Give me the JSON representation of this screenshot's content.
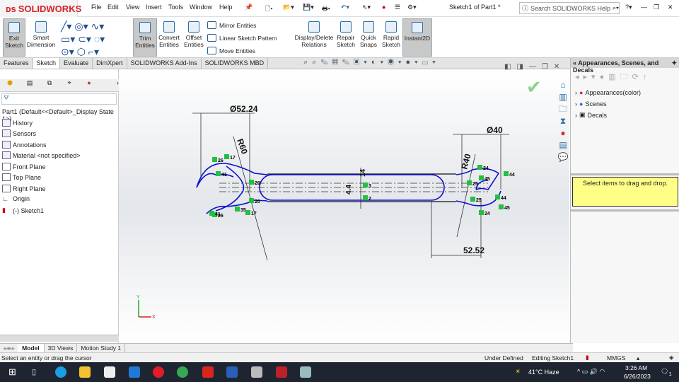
{
  "app": {
    "brand": "SOLIDWORKS",
    "title": "Sketch1 of Part1 *",
    "search_placeholder": "Search SOLIDWORKS Help"
  },
  "menu": [
    "File",
    "Edit",
    "View",
    "Insert",
    "Tools",
    "Window",
    "Help"
  ],
  "commands": {
    "exit_sketch": "Exit Sketch",
    "smart_dimension": "Smart Dimension",
    "trim": "Trim Entities",
    "convert": "Convert Entities",
    "offset": "Offset Entities",
    "mirror": "Mirror Entities",
    "linear_pattern": "Linear Sketch Pattern",
    "move": "Move Entities",
    "display_relations": "Display/Delete Relations",
    "repair": "Repair Sketch",
    "quick_snaps": "Quick Snaps",
    "rapid": "Rapid Sketch",
    "instant2d": "Instant2D"
  },
  "tabs": [
    "Features",
    "Sketch",
    "Evaluate",
    "DimXpert",
    "SOLIDWORKS Add-Ins",
    "SOLIDWORKS MBD"
  ],
  "tree": {
    "root": "Part1  (Default<<Default>_Display State 1>)",
    "items": [
      "History",
      "Sensors",
      "Annotations",
      "Material <not specified>",
      "Front Plane",
      "Top Plane",
      "Right Plane",
      "Origin",
      "(-) Sketch1"
    ]
  },
  "sketch": {
    "dims": {
      "d1": "Ø52.24",
      "d2": "Ø40",
      "r1": "R60",
      "r2": "R40",
      "len": "52.52",
      "w1": "14",
      "w2": "4.4"
    },
    "relations": [
      "26",
      "17",
      "41",
      "20",
      "20",
      "35",
      "26",
      "17",
      "41",
      "3",
      "2",
      "24",
      "25",
      "25",
      "44",
      "45",
      "44",
      "45",
      "24"
    ],
    "colors": {
      "sketch": "#1010d0",
      "relation": "#22c040"
    }
  },
  "task_pane": {
    "title": "Appearances, Scenes, and Decals",
    "items": [
      "Appearances(color)",
      "Scenes",
      "Decals"
    ],
    "hint": "Select items to drag and drop."
  },
  "bottom_tabs": [
    "Model",
    "3D Views",
    "Motion Study 1"
  ],
  "status": {
    "message": "Select an entity or drag the cursor",
    "state": "Under Defined",
    "editing": "Editing Sketch1",
    "units": "MMGS"
  },
  "taskbar": {
    "weather": "41°C  Haze",
    "time": "3:26 AM",
    "date": "6/26/2023",
    "notifications": "1"
  }
}
